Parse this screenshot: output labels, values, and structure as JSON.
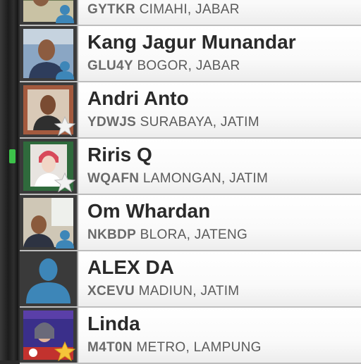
{
  "contacts": [
    {
      "name": "",
      "callsign": "GYTKR",
      "location": "CIMAHI, JABAR",
      "avatar": "photo",
      "badge": "person-icon"
    },
    {
      "name": "Kang Jagur Munandar",
      "callsign": "GLU4Y",
      "location": "BOGOR, JABAR",
      "avatar": "photo",
      "badge": "person-icon"
    },
    {
      "name": "Andri Anto",
      "callsign": "YDWJS",
      "location": "SURABAYA, JATIM",
      "avatar": "photo",
      "badge": "star-icon"
    },
    {
      "name": "Riris Q",
      "callsign": "WQAFN",
      "location": "LAMONGAN, JATIM",
      "avatar": "photo",
      "badge": "star-icon"
    },
    {
      "name": "Om Whardan",
      "callsign": "NKBDP",
      "location": "BLORA, JATENG",
      "avatar": "photo",
      "badge": "person-icon"
    },
    {
      "name": "ALEX DA",
      "callsign": "XCEVU",
      "location": "MADIUN, JATIM",
      "avatar": "default-person-icon",
      "badge": ""
    },
    {
      "name": "Linda",
      "callsign": "M4T0N",
      "location": "METRO, LAMPUNG",
      "avatar": "photo",
      "badge": "star-icon"
    }
  ],
  "colors": {
    "accent_button": "#3cc24a",
    "badge_blue": "#3d86b8",
    "name_text": "#2a2a2a",
    "sub_text": "#555555"
  }
}
